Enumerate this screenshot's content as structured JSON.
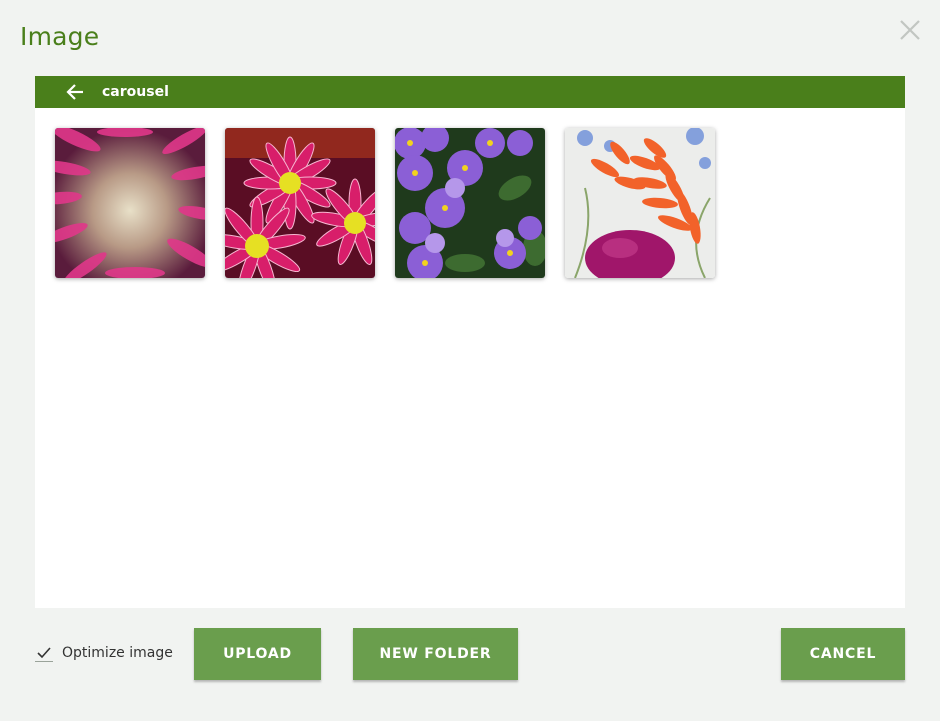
{
  "dialog": {
    "title": "Image",
    "close_icon": "close-icon"
  },
  "folder_bar": {
    "back_icon": "arrow-left-icon",
    "folder_name": "carousel",
    "accent_color": "#4a7f1b"
  },
  "images": [
    {
      "name": "pink-daisy-closeup",
      "description_icon": "image-thumbnail"
    },
    {
      "name": "magenta-chrysanthemums",
      "description_icon": "image-thumbnail"
    },
    {
      "name": "purple-violas",
      "description_icon": "image-thumbnail"
    },
    {
      "name": "orange-red-hot-poker",
      "description_icon": "image-thumbnail"
    }
  ],
  "footer": {
    "optimize_label": "Optimize image",
    "optimize_checked": true,
    "upload_label": "UPLOAD",
    "new_folder_label": "NEW FOLDER",
    "cancel_label": "CANCEL",
    "button_color": "#6a9e4d"
  }
}
